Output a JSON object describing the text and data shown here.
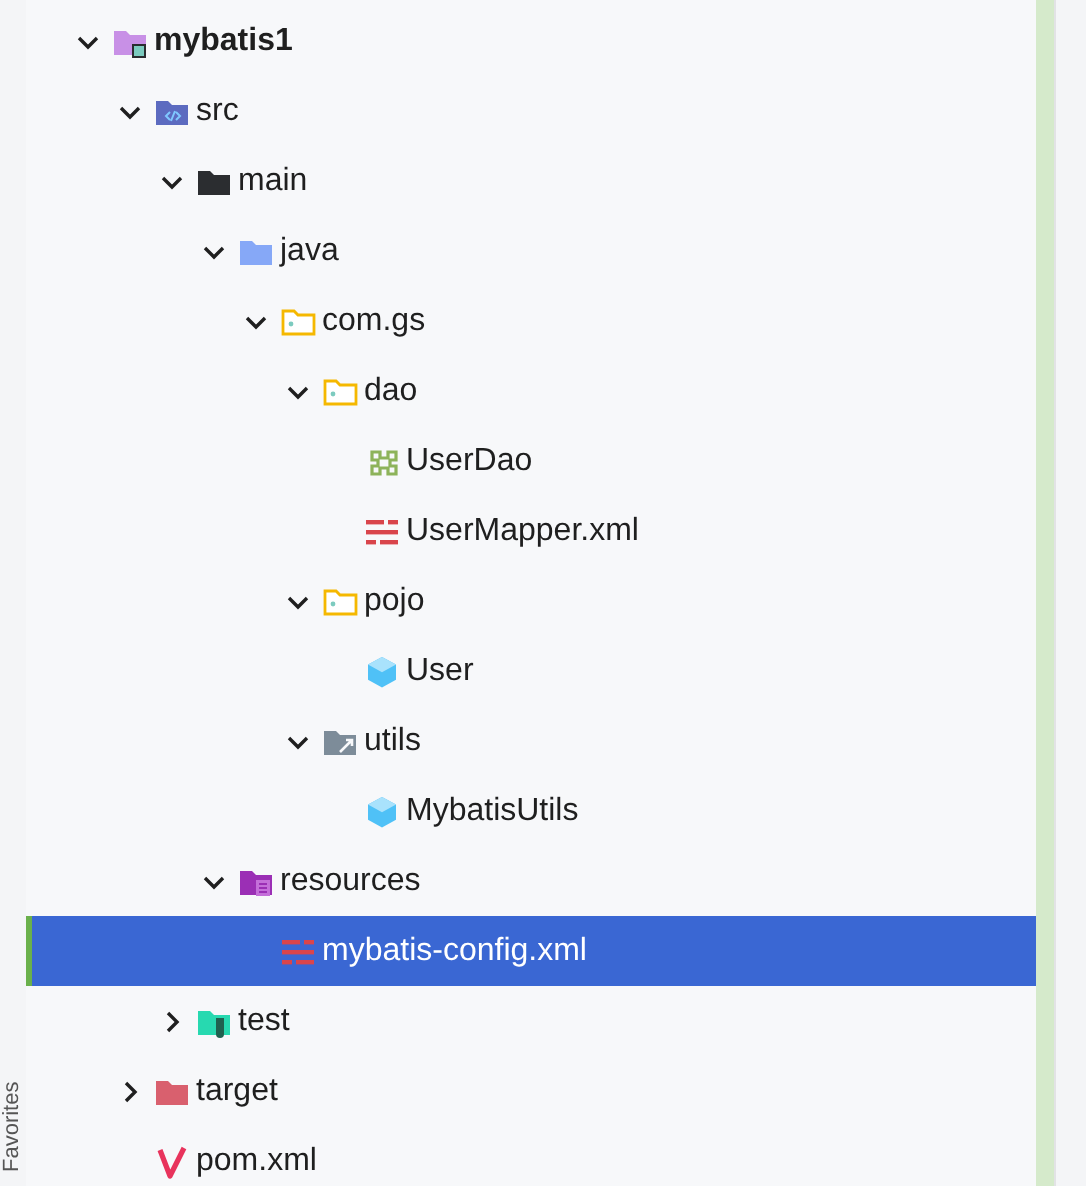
{
  "side_bar": {
    "label": "Favorites"
  },
  "tree": {
    "items": [
      {
        "label": "mybatis1",
        "kind": "project",
        "expanded": true,
        "selected": false,
        "children": [
          {
            "label": "src",
            "kind": "source",
            "expanded": true,
            "selected": false,
            "children": [
              {
                "label": "main",
                "kind": "folder",
                "expanded": true,
                "selected": false,
                "children": [
                  {
                    "label": "java",
                    "kind": "java",
                    "expanded": true,
                    "selected": false,
                    "children": [
                      {
                        "label": "com.gs",
                        "kind": "package",
                        "expanded": true,
                        "selected": false,
                        "children": [
                          {
                            "label": "dao",
                            "kind": "package",
                            "expanded": true,
                            "selected": false,
                            "children": [
                              {
                                "label": "UserDao",
                                "kind": "interface",
                                "selected": false
                              },
                              {
                                "label": "UserMapper.xml",
                                "kind": "xml",
                                "selected": false
                              }
                            ]
                          },
                          {
                            "label": "pojo",
                            "kind": "package",
                            "expanded": true,
                            "selected": false,
                            "children": [
                              {
                                "label": "User",
                                "kind": "class",
                                "selected": false
                              }
                            ]
                          },
                          {
                            "label": "utils",
                            "kind": "utils",
                            "expanded": true,
                            "selected": false,
                            "children": [
                              {
                                "label": "MybatisUtils",
                                "kind": "class",
                                "selected": false
                              }
                            ]
                          }
                        ]
                      }
                    ]
                  },
                  {
                    "label": "resources",
                    "kind": "resources",
                    "expanded": true,
                    "selected": false,
                    "children": [
                      {
                        "label": "mybatis-config.xml",
                        "kind": "xml",
                        "selected": true
                      }
                    ]
                  }
                ]
              },
              {
                "label": "test",
                "kind": "test",
                "expanded": false,
                "selected": false
              }
            ]
          },
          {
            "label": "target",
            "kind": "excluded",
            "expanded": false,
            "selected": false
          },
          {
            "label": "pom.xml",
            "kind": "maven",
            "selected": false
          }
        ]
      }
    ]
  }
}
